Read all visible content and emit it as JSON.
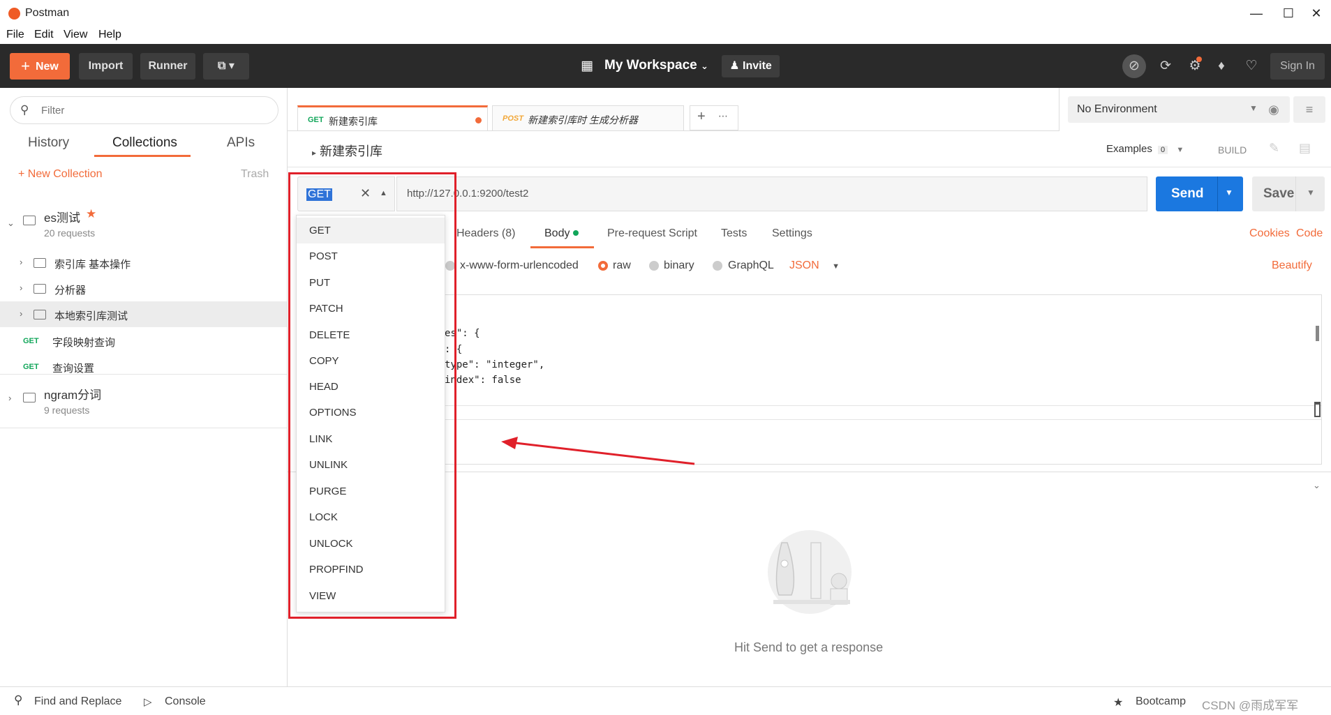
{
  "app": {
    "title": "Postman"
  },
  "menu": [
    "File",
    "Edit",
    "View",
    "Help"
  ],
  "header": {
    "new_label": "New",
    "import_label": "Import",
    "runner_label": "Runner",
    "workspace_label": "My Workspace",
    "invite_label": "Invite",
    "signin_label": "Sign In"
  },
  "sidebar": {
    "filter_placeholder": "Filter",
    "tabs": [
      "History",
      "Collections",
      "APIs"
    ],
    "active_tab": "Collections",
    "new_collection_label": "New Collection",
    "trash_label": "Trash",
    "collections": [
      {
        "name": "es测试",
        "sub": "20 requests",
        "starred": true,
        "items": [
          {
            "type": "folder",
            "label": "索引库 基本操作"
          },
          {
            "type": "folder",
            "label": "分析器"
          },
          {
            "type": "folder",
            "label": "本地索引库测试"
          },
          {
            "type": "request",
            "method": "GET",
            "label": "字段映射查询"
          },
          {
            "type": "request",
            "method": "GET",
            "label": "查询设置"
          }
        ]
      },
      {
        "name": "ngram分词",
        "sub": "9 requests"
      }
    ]
  },
  "tabs": [
    {
      "method": "GET",
      "name": "新建索引库",
      "color": "#11a65a"
    },
    {
      "method": "POST",
      "name": "新建索引库时 生成分析器",
      "color": "#f2a83a"
    }
  ],
  "environment": {
    "selected": "No Environment"
  },
  "request": {
    "title": "新建索引库",
    "examples_label": "Examples",
    "examples_count": "0",
    "build_label": "BUILD",
    "method": "GET",
    "url": "http://127.0.0.1:9200/test2",
    "send_label": "Send",
    "save_label": "Save",
    "subtabs": [
      "Headers (8)",
      "Body",
      "Pre-request Script",
      "Tests",
      "Settings"
    ],
    "cookies_label": "Cookies",
    "code_label": "Code",
    "body_options": [
      "x-www-form-urlencoded",
      "raw",
      "binary",
      "GraphQL"
    ],
    "body_format": "JSON",
    "beautify_label": "Beautify",
    "code_lines": [
      "es\": {",
      ": {",
      "type\": \"integer\",",
      "index\": false"
    ]
  },
  "method_dropdown": [
    "GET",
    "POST",
    "PUT",
    "PATCH",
    "DELETE",
    "COPY",
    "HEAD",
    "OPTIONS",
    "LINK",
    "UNLINK",
    "PURGE",
    "LOCK",
    "UNLOCK",
    "PROPFIND",
    "VIEW"
  ],
  "response": {
    "hint": "Hit Send to get a response"
  },
  "bottom": {
    "find_replace": "Find and Replace",
    "console": "Console",
    "bootcamp": "Bootcamp",
    "watermark": "CSDN @雨成军军"
  },
  "colors": {
    "accent": "#f26b3a",
    "send": "#1b78e0",
    "annotation": "#e0202a"
  }
}
